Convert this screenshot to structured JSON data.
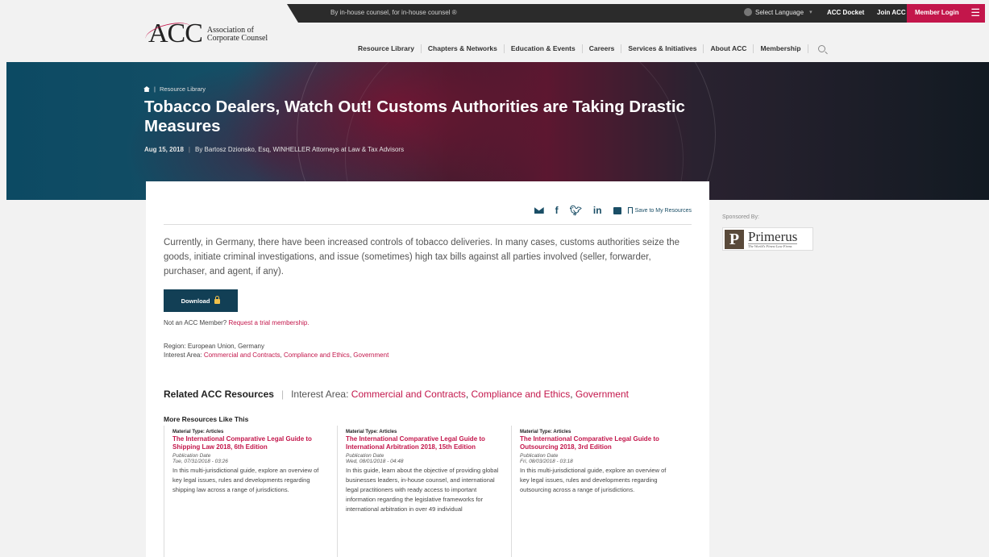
{
  "topbar": {
    "tagline": "By in-house counsel, for in-house counsel ®",
    "language": "Select Language",
    "acc_docket": "ACC Docket",
    "join": "Join ACC",
    "member_login": "Member Login"
  },
  "logo": {
    "mark": "ACC",
    "line1": "Association of",
    "line2": "Corporate Counsel"
  },
  "nav": [
    "Resource Library",
    "Chapters & Networks",
    "Education & Events",
    "Careers",
    "Services & Initiatives",
    "About ACC",
    "Membership"
  ],
  "hero": {
    "breadcrumb": "Resource Library",
    "title": "Tobacco Dealers, Watch Out! Customs Authorities are Taking Drastic Measures",
    "date": "Aug 15, 2018",
    "byline": "By Bartosz Dzionsko, Esq, WINHELLER Attorneys at Law & Tax Advisors"
  },
  "article": {
    "save_label": "Save to My Resources",
    "intro": "Currently, in Germany, there have been increased controls of tobacco deliveries. In many cases, customs authorities seize the goods, initiate criminal investigations, and issue (sometimes) high tax bills against all parties involved (seller, forwarder, purchaser, and agent, if any).",
    "download_label": "Download",
    "not_member": "Not an ACC Member?",
    "trial_link": "Request a trial membership.",
    "region_label": "Region:",
    "region_value": "European Union, Germany",
    "interest_label": "Interest Area:",
    "interest_1": "Commercial and Contracts",
    "interest_2": "Compliance and Ethics",
    "interest_3": "Government"
  },
  "related": {
    "heading": "Related ACC Resources",
    "area_label": "Interest Area:",
    "area_1": "Commercial and Contracts",
    "area_2": "Compliance and Ethics",
    "area_3": "Government",
    "more": "More Resources Like This",
    "items": [
      {
        "type": "Material Type: Articles",
        "title": "The International Comparative Legal Guide to Shipping Law 2018, 6th Edition",
        "pub_label": "Publication Date",
        "pub_date": "Tue, 07/31/2018 - 03:26",
        "desc": "In this multi-jurisdictional guide, explore an overview of key legal issues, rules and developments regarding shipping law across a range of jurisdictions."
      },
      {
        "type": "Material Type: Articles",
        "title": "The International Comparative Legal Guide to International Arbitration 2018, 15th Edition",
        "pub_label": "Publication Date",
        "pub_date": "Wed, 08/01/2018 - 04:48",
        "desc": "In this guide, learn about the objective of providing global businesses leaders, in-house counsel, and international legal practitioners with ready access to important information regarding the legislative frameworks for international arbitration in over 49 individual"
      },
      {
        "type": "Material Type: Articles",
        "title": "The International Comparative Legal Guide to Outsourcing 2018, 3rd Edition",
        "pub_label": "Publication Date",
        "pub_date": "Fri, 08/03/2018 - 03:18",
        "desc": "In this multi-jurisdictional guide, explore an overview of key legal issues, rules and developments regarding outsourcing across a range of jurisdictions."
      }
    ]
  },
  "sidebar": {
    "sponsored": "Sponsored By:",
    "sponsor_name": "Primerus",
    "sponsor_tagline": "The World's Finest Law Firms"
  },
  "colors": {
    "accent": "#c3164b",
    "navy": "#123f55",
    "topbar": "#2b2b2b"
  }
}
